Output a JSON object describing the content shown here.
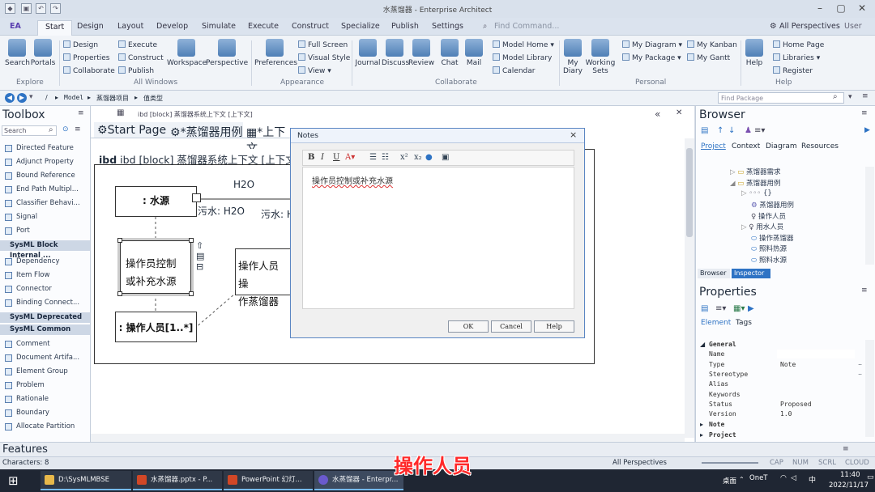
{
  "window": {
    "title": "水蒸馏器 - Enterprise Architect",
    "minimize": "–",
    "maximize": "▢",
    "close": "✕"
  },
  "menu": {
    "logo": "EA",
    "tabs": [
      "Start",
      "Design",
      "Layout",
      "Develop",
      "Simulate",
      "Execute",
      "Construct",
      "Specialize",
      "Publish",
      "Settings"
    ],
    "active": "Start",
    "find_placeholder": "Find Command...",
    "perspectives": "All Perspectives",
    "user": "User"
  },
  "ribbon": {
    "search": "Search",
    "portals": "Portals",
    "design": "Design",
    "properties": "Properties",
    "collaborate": "Collaborate",
    "execute": "Execute",
    "construct": "Construct",
    "publish": "Publish",
    "workspace": "Workspace",
    "perspective": "Perspective",
    "preferences": "Preferences",
    "full_screen": "Full Screen",
    "visual_style": "Visual Style",
    "view": "View",
    "journal": "Journal",
    "discuss": "Discuss",
    "review": "Review",
    "chat": "Chat",
    "mail": "Mail",
    "model_home": "Model Home",
    "model_library": "Model Library",
    "calendar": "Calendar",
    "my_diary_1": "My",
    "my_diary_2": "Diary",
    "working_sets_1": "Working",
    "working_sets_2": "Sets",
    "my_diagram": "My Diagram",
    "my_package": "My Package",
    "my_kanban": "My Kanban",
    "my_gantt": "My Gantt",
    "help": "Help",
    "home_page": "Home Page",
    "libraries": "Libraries",
    "register": "Register",
    "groups": {
      "explore": "Explore",
      "all_windows": "All Windows",
      "appearance": "Appearance",
      "collaborate": "Collaborate",
      "personal": "Personal",
      "help": "Help"
    }
  },
  "path": {
    "segments": [
      "/",
      "Model",
      "蒸馏器项目",
      "值类型"
    ],
    "find_package": "Find Package"
  },
  "toolbox": {
    "title": "Toolbox",
    "search": "Search",
    "items1": [
      "Directed Feature",
      "Adjunct Property",
      "Bound Reference",
      "End Path Multipl...",
      "Classifier Behavi...",
      "Signal",
      "Port"
    ],
    "section1": "SysML Block Internal ...",
    "items2": [
      "Dependency",
      "Item Flow",
      "Connector",
      "Binding Connect..."
    ],
    "section2": "SysML Deprecated",
    "section3": "SysML Common",
    "items3": [
      "Comment",
      "Document Artifa...",
      "Element Group",
      "Problem",
      "Rationale",
      "Boundary",
      "Allocate Partition"
    ]
  },
  "diagram": {
    "tabs": [
      "Start Page",
      "*蒸馏器用例",
      "*上下文"
    ],
    "frame_title": "ibd [block] 蒸馏器系统上下文 [上下文]",
    "water_source": ": 水源",
    "h2o": "H2O",
    "waste1": "污水: H2O",
    "waste2": "污水: H",
    "note_line1": "操作员控制",
    "note_line2": "或补充水源",
    "operator": ": 操作人员[1..*]",
    "op_note_line1": "操作人员操",
    "op_note_line2": "作蒸馏器"
  },
  "dialog": {
    "title": "Notes",
    "close": "×",
    "bold": "B",
    "italic": "I",
    "underline": "U",
    "text": "操作员控制或补充水源",
    "ok": "OK",
    "cancel": "Cancel",
    "help": "Help"
  },
  "browser": {
    "title": "Browser",
    "tabs": [
      "Project",
      "Context",
      "Diagram",
      "Resources"
    ],
    "tree": [
      "蒸馏器需求",
      "蒸馏器用例",
      "{}",
      "蒸馏器用例",
      "操作人员",
      "用水人员",
      "操作蒸馏器",
      "照料热源",
      "照料水源",
      "…"
    ],
    "bottom_tabs": [
      "Browser",
      "Inspector"
    ]
  },
  "properties": {
    "title": "Properties",
    "tabs": [
      "Element",
      "Tags"
    ],
    "rows": [
      {
        "k": "General",
        "v": ""
      },
      {
        "k": "Name",
        "v": ""
      },
      {
        "k": "Type",
        "v": "Note"
      },
      {
        "k": "Stereotype",
        "v": ""
      },
      {
        "k": "Alias",
        "v": ""
      },
      {
        "k": "Keywords",
        "v": ""
      },
      {
        "k": "Status",
        "v": "Proposed"
      },
      {
        "k": "Version",
        "v": "1.0"
      },
      {
        "k": "Note",
        "v": ""
      },
      {
        "k": "Project",
        "v": ""
      }
    ]
  },
  "features": {
    "title": "Features"
  },
  "status": {
    "chars": "Characters: 8",
    "perspectives": "All Perspectives",
    "caps": "CAP",
    "num": "NUM",
    "scrl": "SCRL",
    "cloud": "CLOUD"
  },
  "taskbar": {
    "items": [
      "D:\\SysMLMBSE",
      "水蒸馏器.pptx - P...",
      "PowerPoint 幻灯...",
      "水蒸馏器 - Enterpr..."
    ],
    "desktop": "桌面",
    "onenote": "OneT",
    "ime": "中",
    "time": "11:40",
    "date": "2022/11/17"
  },
  "caption": "操作人员",
  "colors": {
    "accent": "#2e73c4",
    "caption": "#ff2a2a",
    "taskbar": "#1f2633"
  }
}
